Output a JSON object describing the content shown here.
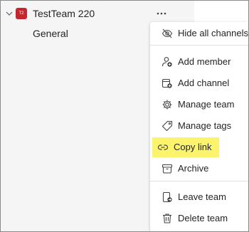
{
  "team": {
    "avatar_initials": "T2",
    "avatar_color": "#c4262e",
    "name": "TestTeam 220",
    "more_label": "···"
  },
  "channels": [
    {
      "label": "General"
    }
  ],
  "menu": {
    "items": [
      {
        "label": "Hide all channels",
        "icon": "eye-off-icon"
      },
      {
        "label": "Add member",
        "icon": "add-person-icon"
      },
      {
        "label": "Add channel",
        "icon": "add-channel-icon"
      },
      {
        "label": "Manage team",
        "icon": "gear-icon"
      },
      {
        "label": "Manage tags",
        "icon": "tag-icon"
      },
      {
        "label": "Copy link",
        "icon": "link-icon",
        "highlighted": true,
        "highlight_color": "#fdf46d"
      },
      {
        "label": "Archive",
        "icon": "archive-icon"
      },
      {
        "label": "Leave team",
        "icon": "leave-icon"
      },
      {
        "label": "Delete team",
        "icon": "trash-icon"
      }
    ]
  }
}
